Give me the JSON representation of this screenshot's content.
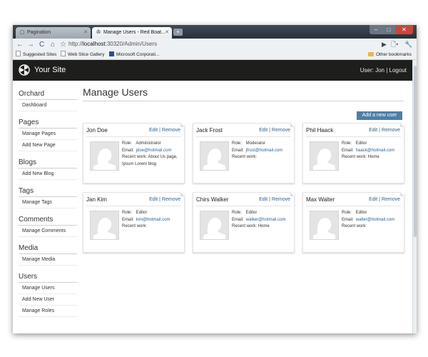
{
  "browser": {
    "tabs": [
      {
        "label": "Pagination",
        "active": false
      },
      {
        "label": "Manage Users - Red Boat...",
        "active": true
      }
    ],
    "new_tab_label": "+",
    "window_buttons": {
      "minimize": "–",
      "maximize": "□",
      "close": "✕"
    },
    "url_prefix": "http://",
    "url_host": "localhost",
    "url_rest": ":30320/Admin/Users",
    "bookmarks": [
      {
        "label": "Suggested Sites",
        "icon": "page-icon"
      },
      {
        "label": "Web Slice Gallery",
        "icon": "page-icon"
      },
      {
        "label": "Microsoft Corporati...",
        "icon": "msn-icon"
      }
    ],
    "other_bookmarks": "Other bookmarks"
  },
  "site": {
    "title": "Your Site",
    "user_prefix": "User: ",
    "user_name": "Jon",
    "logout": "Logout"
  },
  "sidebar": {
    "groups": [
      {
        "title": "Orchard",
        "items": [
          "Dashboard"
        ]
      },
      {
        "title": "Pages",
        "items": [
          "Manage Pages",
          "Add New Page"
        ]
      },
      {
        "title": "Blogs",
        "items": [
          "Add New Blog"
        ]
      },
      {
        "title": "Tags",
        "items": [
          "Manage Tags"
        ]
      },
      {
        "title": "Comments",
        "items": [
          "Manage Comments"
        ]
      },
      {
        "title": "Media",
        "items": [
          "Manage Media"
        ]
      },
      {
        "title": "Users",
        "items": [
          "Manage Users",
          "Add New User",
          "Manage Roles"
        ]
      }
    ]
  },
  "main": {
    "title": "Manage Users",
    "add_button": "Add a new user",
    "edit_label": "Edit",
    "remove_label": "Remove",
    "role_label": "Role:",
    "email_label": "Email:",
    "recent_label": "Recent work:",
    "users": [
      {
        "name": "Jon Doe",
        "role": "Administrator",
        "email": "jdoe@hotmail.com",
        "recent": "About Us page, Ipsum Lorem blog"
      },
      {
        "name": "Jack Frost",
        "role": "Moderator",
        "email": "jfrost@hotmail.com",
        "recent": ""
      },
      {
        "name": "Phil Haack",
        "role": "Editor",
        "email": "haack@hotmail.com",
        "recent": "Home"
      },
      {
        "name": "Jan Kim",
        "role": "Editor",
        "email": "kim@hotmail.com",
        "recent": ""
      },
      {
        "name": "Chirs Walker",
        "role": "Editor",
        "email": "walker@hotmail.com",
        "recent": "Home"
      },
      {
        "name": "Max Walter",
        "role": "Editor",
        "email": "walter@hotmail.com",
        "recent": ""
      }
    ]
  },
  "colors": {
    "header_bg": "#1e1f1c",
    "accent_link": "#2a5f8f",
    "button_bg": "#4c7fa7"
  }
}
